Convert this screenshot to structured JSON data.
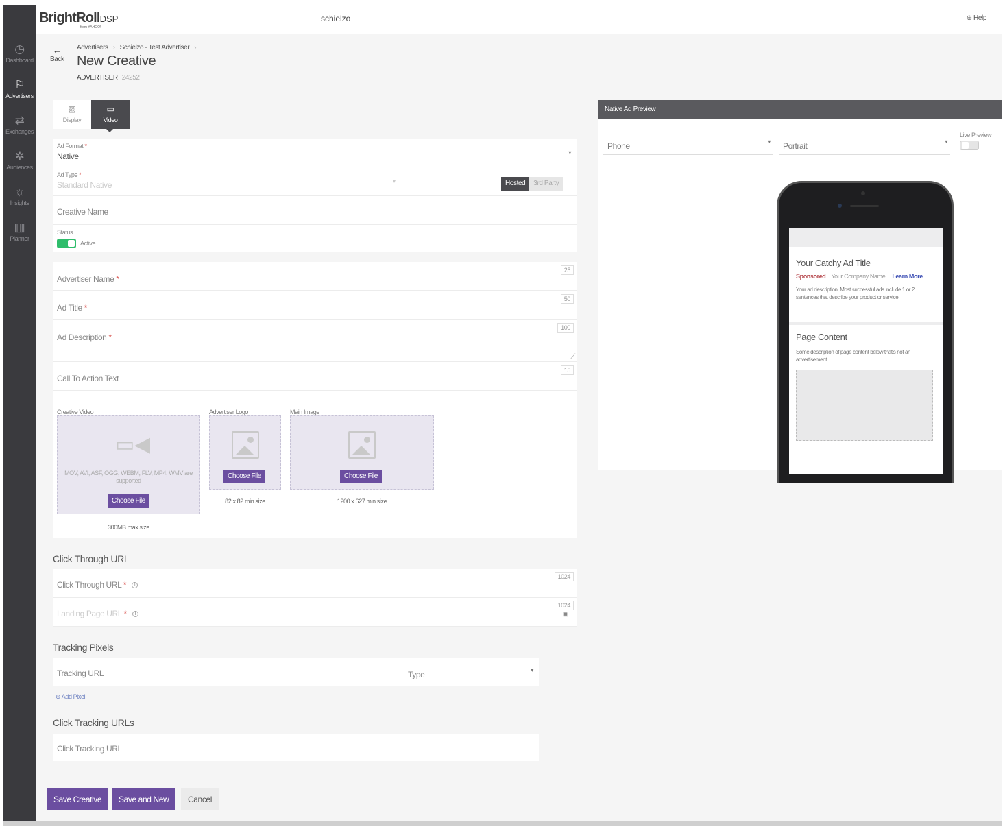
{
  "app": {
    "brand": "BrightRoll",
    "brand_suffix": "DSP",
    "brand_sub": "from YAHOO!",
    "search_value": "schielzo",
    "help": "Help"
  },
  "sidebar": {
    "items": [
      {
        "label": "Dashboard",
        "icon": "gauge-icon"
      },
      {
        "label": "Advertisers",
        "icon": "flag-icon"
      },
      {
        "label": "Exchanges",
        "icon": "exchange-arrows-icon"
      },
      {
        "label": "Audiences",
        "icon": "audiences-icon"
      },
      {
        "label": "Insights",
        "icon": "lightbulb-icon"
      },
      {
        "label": "Planner",
        "icon": "bar-chart-icon"
      }
    ]
  },
  "header": {
    "back": "Back",
    "breadcrumbs": [
      "Advertisers",
      "Schielzo - Test Advertiser"
    ],
    "title": "New Creative",
    "advertiser_label": "ADVERTISER",
    "advertiser_id": "24252"
  },
  "tabs": [
    {
      "label": "Display",
      "icon": "image-icon"
    },
    {
      "label": "Video",
      "icon": "video-camera-icon"
    }
  ],
  "form": {
    "ad_format": {
      "label": "Ad Format",
      "value": "Native"
    },
    "ad_type": {
      "label": "Ad Type",
      "value": "Standard Native",
      "hosted": "Hosted",
      "third_party": "3rd Party"
    },
    "creative_name": "Creative Name",
    "status": {
      "label": "Status",
      "value": "Active"
    },
    "advertiser_name": {
      "label": "Advertiser Name",
      "max": "25"
    },
    "ad_title": {
      "label": "Ad Title",
      "max": "50"
    },
    "ad_description": {
      "label": "Ad Description",
      "max": "100"
    },
    "cta": {
      "label": "Call To Action Text",
      "max": "15"
    },
    "uploads": {
      "video": {
        "label": "Creative Video",
        "formats": "MOV, AVI, ASF, OGG, WEBM, FLV, MP4, WMV are supported",
        "button": "Choose File",
        "note": "300MB max size"
      },
      "logo": {
        "label": "Advertiser Logo",
        "button": "Choose File",
        "note": "82 x 82 min size"
      },
      "image": {
        "label": "Main Image",
        "button": "Choose File",
        "note": "1200 x 627 min size"
      }
    }
  },
  "click_through": {
    "title": "Click Through URL",
    "url_label": "Click Through URL",
    "url_max": "1024",
    "landing_label": "Landing Page URL",
    "landing_max": "1024"
  },
  "tracking": {
    "title": "Tracking Pixels",
    "url_placeholder": "Tracking URL",
    "type_placeholder": "Type",
    "add": "Add Pixel"
  },
  "click_tracking": {
    "title": "Click Tracking URLs",
    "placeholder": "Click Tracking URL"
  },
  "footer": {
    "save": "Save Creative",
    "save_new": "Save and New",
    "cancel": "Cancel"
  },
  "preview": {
    "title": "Native Ad Preview",
    "device": "Phone",
    "orientation": "Portrait",
    "live_label": "Live Preview",
    "ad_title": "Your Catchy Ad Title",
    "sponsored": "Sponsored",
    "company": "Your Company Name",
    "learn_more": "Learn More",
    "ad_desc": "Your ad description. Most successful ads include 1 or 2 sentences that describe your product or service.",
    "page_title": "Page Content",
    "page_desc": "Some description of page content below that's not an advertisement."
  },
  "colors": {
    "accent": "#6b4ea0",
    "sidebar": "#3a3a3e",
    "toggle_on": "#2ebd6b",
    "sponsored": "#b5444a",
    "link": "#3f51b5"
  }
}
